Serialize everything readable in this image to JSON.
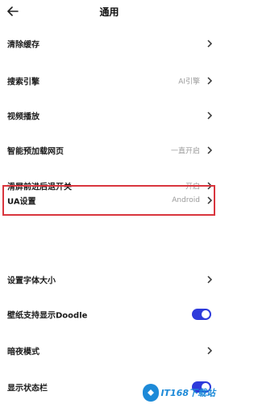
{
  "header": {
    "title": "通用"
  },
  "settings": [
    {
      "label": "清除缓存",
      "value": "",
      "control": "chevron"
    },
    {
      "label": "搜索引擎",
      "value": "AI引擎",
      "control": "chevron"
    },
    {
      "label": "视频播放",
      "value": "",
      "control": "chevron"
    },
    {
      "label": "智能预加载网页",
      "value": "一直开启",
      "control": "chevron"
    },
    {
      "label": "滑屏前进后退开关",
      "value": "开启",
      "control": "chevron"
    },
    {
      "label": "UA设置",
      "value": "Android",
      "control": "chevron",
      "highlighted": true
    },
    {
      "label": "设置字体大小",
      "value": "",
      "control": "chevron"
    },
    {
      "label": "壁纸支持显示Doodle",
      "value": "",
      "control": "toggle",
      "state": "on"
    },
    {
      "label": "暗夜模式",
      "value": "",
      "control": "chevron"
    },
    {
      "label": "显示状态栏",
      "value": "",
      "control": "toggle",
      "state": "on"
    }
  ],
  "watermark": {
    "text": "IT168下载站"
  },
  "colors": {
    "toggle_on": "#2e3bdb",
    "highlight_border": "#d9363e",
    "watermark": "#1d8ad8"
  }
}
